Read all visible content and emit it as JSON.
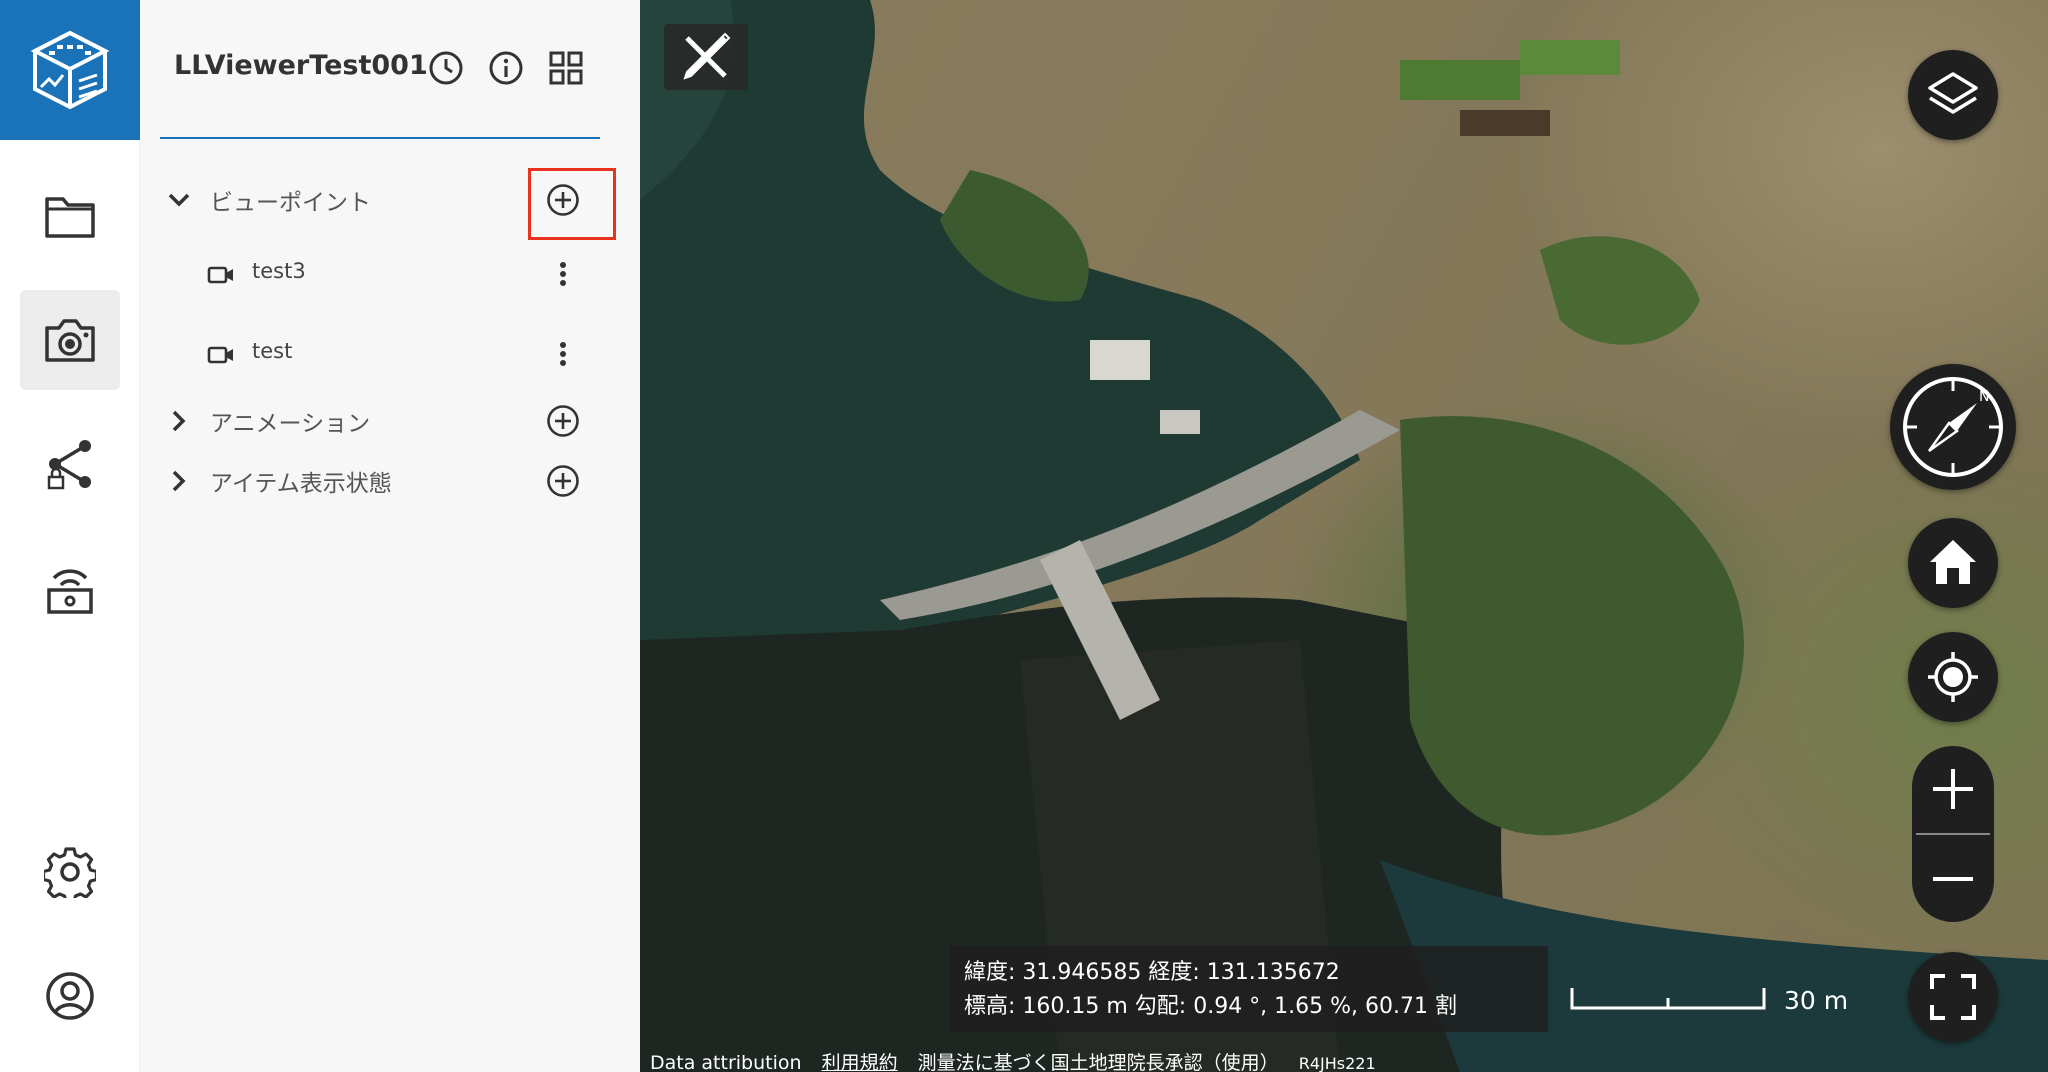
{
  "app": {
    "project_title": "LLViewerTest001"
  },
  "rail": {
    "items": [
      {
        "name": "folder-icon"
      },
      {
        "name": "camera-icon",
        "active": true
      },
      {
        "name": "share-lock-icon"
      },
      {
        "name": "broadcast-icon"
      },
      {
        "name": "gear-icon"
      },
      {
        "name": "account-icon"
      }
    ]
  },
  "panel": {
    "sections": [
      {
        "label": "ビューポイント",
        "expanded": true
      },
      {
        "label": "アニメーション",
        "expanded": false
      },
      {
        "label": "アイテム表示状態",
        "expanded": false
      }
    ],
    "viewpoints": [
      {
        "label": "test3"
      },
      {
        "label": "test"
      }
    ]
  },
  "map": {
    "coords_line1": "緯度: 31.946585   経度: 131.135672",
    "coords_line2": "標高: 160.15 m   勾配: 0.94 °, 1.65 %, 60.71 割",
    "scale_label": "30 m",
    "attribution": {
      "data": "Data attribution",
      "terms": "利用規約",
      "survey": "測量法に基づく国土地理院長承認（使用）",
      "code": "R4JHs221"
    }
  },
  "colors": {
    "brand": "#1a73b8",
    "highlight": "#e8321e",
    "panel_bg": "#f7f7f7"
  }
}
